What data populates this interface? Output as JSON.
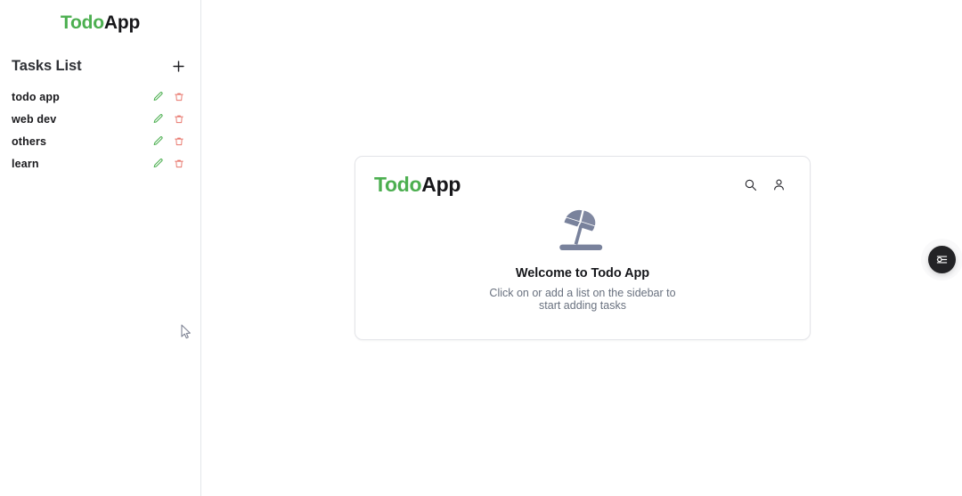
{
  "app": {
    "logo_accent": "Todo",
    "logo_dark": "App",
    "accent_color": "#4caf50",
    "dark_color": "#17171a"
  },
  "sidebar": {
    "logo_accent": "Todo",
    "logo_dark": "App",
    "section_title": "Tasks List",
    "add_button_icon": "plus-icon",
    "items": [
      {
        "label": "todo app",
        "edit_icon": "pencil-icon",
        "delete_icon": "trash-icon"
      },
      {
        "label": "web dev",
        "edit_icon": "pencil-icon",
        "delete_icon": "trash-icon"
      },
      {
        "label": "others",
        "edit_icon": "pencil-icon",
        "delete_icon": "trash-icon"
      },
      {
        "label": "learn",
        "edit_icon": "pencil-icon",
        "delete_icon": "trash-icon"
      }
    ],
    "edit_icon_color": "#4caf50",
    "delete_icon_color": "#e8756b"
  },
  "card": {
    "logo_accent": "Todo",
    "logo_dark": "App",
    "search_icon": "search-icon",
    "account_icon": "user-icon",
    "illustration": "beach-umbrella-icon",
    "illustration_color": "#79829c",
    "empty_title": "Welcome to Todo App",
    "empty_subtitle": "Click on or add a list on the sidebar to start adding tasks"
  },
  "fab": {
    "icon": "sliders-settings-icon",
    "background_color": "#232326"
  },
  "cursor": {
    "icon": "mouse-pointer-icon"
  }
}
